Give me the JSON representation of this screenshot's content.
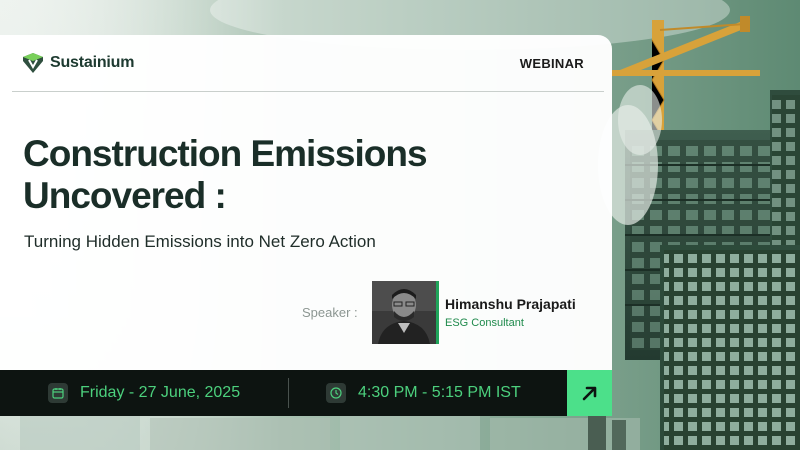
{
  "brand": {
    "name": "Sustainium"
  },
  "header": {
    "tag": "WEBINAR"
  },
  "hero": {
    "title_line1": "Construction Emissions",
    "title_line2": "Uncovered :",
    "subtitle": "Turning Hidden Emissions into Net Zero Action"
  },
  "speaker": {
    "label": "Speaker :",
    "name": "Himanshu Prajapati",
    "role": "ESG Consultant"
  },
  "event": {
    "date": "Friday - 27 June, 2025",
    "time": "4:30 PM - 5:15 PM IST"
  },
  "icons": {
    "logo": "sustainium-logo-icon",
    "date": "calendar-icon",
    "time": "clock-icon",
    "cta": "arrow-up-right-icon"
  },
  "colors": {
    "brand_dark": "#1d3a30",
    "accent_green": "#4ce08a",
    "info_text": "#4cd07d",
    "bar_bg": "#0d1411",
    "role_green": "#1f8a4c"
  }
}
